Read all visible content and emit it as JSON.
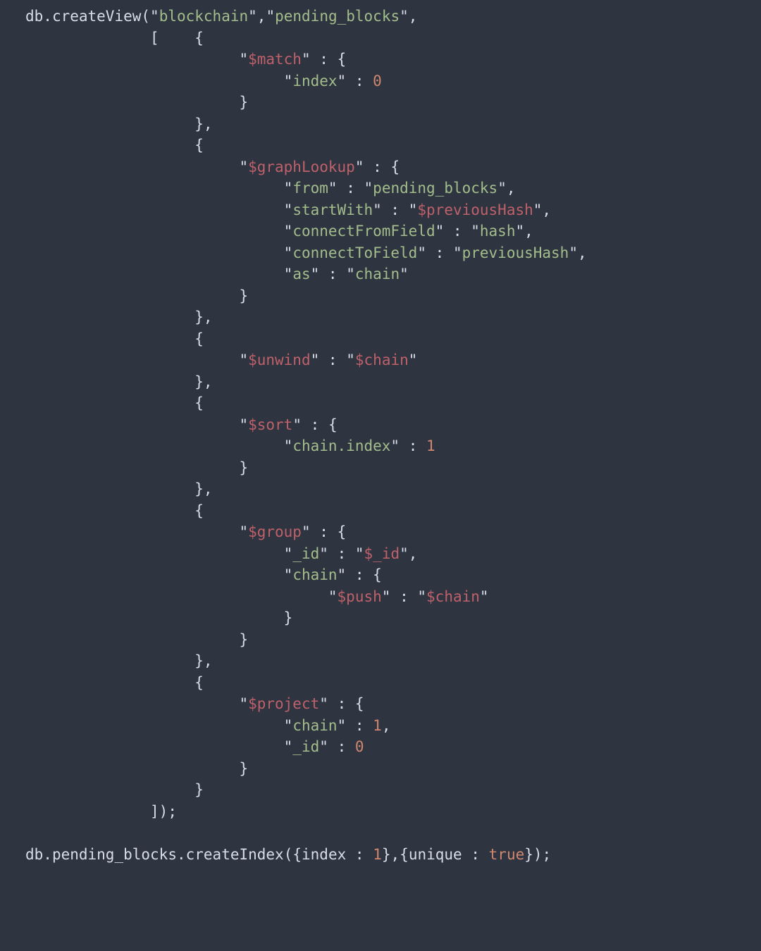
{
  "code": {
    "tokens": [
      {
        "c": "t-ident",
        "t": "db"
      },
      {
        "c": "t-punct",
        "t": "."
      },
      {
        "c": "t-ident",
        "t": "createView"
      },
      {
        "c": "t-punct",
        "t": "("
      },
      {
        "c": "t-punct",
        "t": "\""
      },
      {
        "c": "t-string",
        "t": "blockchain"
      },
      {
        "c": "t-punct",
        "t": "\""
      },
      {
        "c": "t-punct",
        "t": ","
      },
      {
        "c": "t-punct",
        "t": "\""
      },
      {
        "c": "t-string",
        "t": "pending_blocks"
      },
      {
        "c": "t-punct",
        "t": "\""
      },
      {
        "c": "t-punct",
        "t": ","
      },
      {
        "nl": true
      },
      {
        "c": "t-default",
        "t": "              "
      },
      {
        "c": "t-punct",
        "t": "["
      },
      {
        "c": "t-default",
        "t": "    "
      },
      {
        "c": "t-punct",
        "t": "{"
      },
      {
        "nl": true
      },
      {
        "c": "t-default",
        "t": "                        "
      },
      {
        "c": "t-punct",
        "t": "\""
      },
      {
        "c": "t-dollar",
        "t": "$match"
      },
      {
        "c": "t-punct",
        "t": "\""
      },
      {
        "c": "t-default",
        "t": " "
      },
      {
        "c": "t-punct",
        "t": ":"
      },
      {
        "c": "t-default",
        "t": " "
      },
      {
        "c": "t-punct",
        "t": "{"
      },
      {
        "nl": true
      },
      {
        "c": "t-default",
        "t": "                             "
      },
      {
        "c": "t-punct",
        "t": "\""
      },
      {
        "c": "t-string",
        "t": "index"
      },
      {
        "c": "t-punct",
        "t": "\""
      },
      {
        "c": "t-default",
        "t": " "
      },
      {
        "c": "t-punct",
        "t": ":"
      },
      {
        "c": "t-default",
        "t": " "
      },
      {
        "c": "t-number",
        "t": "0"
      },
      {
        "nl": true
      },
      {
        "c": "t-default",
        "t": "                        "
      },
      {
        "c": "t-punct",
        "t": "}"
      },
      {
        "nl": true
      },
      {
        "c": "t-default",
        "t": "                   "
      },
      {
        "c": "t-punct",
        "t": "}"
      },
      {
        "c": "t-punct",
        "t": ","
      },
      {
        "nl": true
      },
      {
        "c": "t-default",
        "t": "                   "
      },
      {
        "c": "t-punct",
        "t": "{"
      },
      {
        "nl": true
      },
      {
        "c": "t-default",
        "t": "                        "
      },
      {
        "c": "t-punct",
        "t": "\""
      },
      {
        "c": "t-dollar",
        "t": "$graphLookup"
      },
      {
        "c": "t-punct",
        "t": "\""
      },
      {
        "c": "t-default",
        "t": " "
      },
      {
        "c": "t-punct",
        "t": ":"
      },
      {
        "c": "t-default",
        "t": " "
      },
      {
        "c": "t-punct",
        "t": "{"
      },
      {
        "nl": true
      },
      {
        "c": "t-default",
        "t": "                             "
      },
      {
        "c": "t-punct",
        "t": "\""
      },
      {
        "c": "t-string",
        "t": "from"
      },
      {
        "c": "t-punct",
        "t": "\""
      },
      {
        "c": "t-default",
        "t": " "
      },
      {
        "c": "t-punct",
        "t": ":"
      },
      {
        "c": "t-default",
        "t": " "
      },
      {
        "c": "t-punct",
        "t": "\""
      },
      {
        "c": "t-string",
        "t": "pending_blocks"
      },
      {
        "c": "t-punct",
        "t": "\""
      },
      {
        "c": "t-punct",
        "t": ","
      },
      {
        "nl": true
      },
      {
        "c": "t-default",
        "t": "                             "
      },
      {
        "c": "t-punct",
        "t": "\""
      },
      {
        "c": "t-string",
        "t": "startWith"
      },
      {
        "c": "t-punct",
        "t": "\""
      },
      {
        "c": "t-default",
        "t": " "
      },
      {
        "c": "t-punct",
        "t": ":"
      },
      {
        "c": "t-default",
        "t": " "
      },
      {
        "c": "t-punct",
        "t": "\""
      },
      {
        "c": "t-dollar",
        "t": "$previousHash"
      },
      {
        "c": "t-punct",
        "t": "\""
      },
      {
        "c": "t-punct",
        "t": ","
      },
      {
        "nl": true
      },
      {
        "c": "t-default",
        "t": "                             "
      },
      {
        "c": "t-punct",
        "t": "\""
      },
      {
        "c": "t-string",
        "t": "connectFromField"
      },
      {
        "c": "t-punct",
        "t": "\""
      },
      {
        "c": "t-default",
        "t": " "
      },
      {
        "c": "t-punct",
        "t": ":"
      },
      {
        "c": "t-default",
        "t": " "
      },
      {
        "c": "t-punct",
        "t": "\""
      },
      {
        "c": "t-string",
        "t": "hash"
      },
      {
        "c": "t-punct",
        "t": "\""
      },
      {
        "c": "t-punct",
        "t": ","
      },
      {
        "nl": true
      },
      {
        "c": "t-default",
        "t": "                             "
      },
      {
        "c": "t-punct",
        "t": "\""
      },
      {
        "c": "t-string",
        "t": "connectToField"
      },
      {
        "c": "t-punct",
        "t": "\""
      },
      {
        "c": "t-default",
        "t": " "
      },
      {
        "c": "t-punct",
        "t": ":"
      },
      {
        "c": "t-default",
        "t": " "
      },
      {
        "c": "t-punct",
        "t": "\""
      },
      {
        "c": "t-string",
        "t": "previousHash"
      },
      {
        "c": "t-punct",
        "t": "\""
      },
      {
        "c": "t-punct",
        "t": ","
      },
      {
        "nl": true
      },
      {
        "c": "t-default",
        "t": "                             "
      },
      {
        "c": "t-punct",
        "t": "\""
      },
      {
        "c": "t-string",
        "t": "as"
      },
      {
        "c": "t-punct",
        "t": "\""
      },
      {
        "c": "t-default",
        "t": " "
      },
      {
        "c": "t-punct",
        "t": ":"
      },
      {
        "c": "t-default",
        "t": " "
      },
      {
        "c": "t-punct",
        "t": "\""
      },
      {
        "c": "t-string",
        "t": "chain"
      },
      {
        "c": "t-punct",
        "t": "\""
      },
      {
        "nl": true
      },
      {
        "c": "t-default",
        "t": "                        "
      },
      {
        "c": "t-punct",
        "t": "}"
      },
      {
        "nl": true
      },
      {
        "c": "t-default",
        "t": "                   "
      },
      {
        "c": "t-punct",
        "t": "}"
      },
      {
        "c": "t-punct",
        "t": ","
      },
      {
        "nl": true
      },
      {
        "c": "t-default",
        "t": "                   "
      },
      {
        "c": "t-punct",
        "t": "{"
      },
      {
        "nl": true
      },
      {
        "c": "t-default",
        "t": "                        "
      },
      {
        "c": "t-punct",
        "t": "\""
      },
      {
        "c": "t-dollar",
        "t": "$unwind"
      },
      {
        "c": "t-punct",
        "t": "\""
      },
      {
        "c": "t-default",
        "t": " "
      },
      {
        "c": "t-punct",
        "t": ":"
      },
      {
        "c": "t-default",
        "t": " "
      },
      {
        "c": "t-punct",
        "t": "\""
      },
      {
        "c": "t-dollar",
        "t": "$chain"
      },
      {
        "c": "t-punct",
        "t": "\""
      },
      {
        "nl": true
      },
      {
        "c": "t-default",
        "t": "                   "
      },
      {
        "c": "t-punct",
        "t": "}"
      },
      {
        "c": "t-punct",
        "t": ","
      },
      {
        "nl": true
      },
      {
        "c": "t-default",
        "t": "                   "
      },
      {
        "c": "t-punct",
        "t": "{"
      },
      {
        "nl": true
      },
      {
        "c": "t-default",
        "t": "                        "
      },
      {
        "c": "t-punct",
        "t": "\""
      },
      {
        "c": "t-dollar",
        "t": "$sort"
      },
      {
        "c": "t-punct",
        "t": "\""
      },
      {
        "c": "t-default",
        "t": " "
      },
      {
        "c": "t-punct",
        "t": ":"
      },
      {
        "c": "t-default",
        "t": " "
      },
      {
        "c": "t-punct",
        "t": "{"
      },
      {
        "nl": true
      },
      {
        "c": "t-default",
        "t": "                             "
      },
      {
        "c": "t-punct",
        "t": "\""
      },
      {
        "c": "t-string",
        "t": "chain.index"
      },
      {
        "c": "t-punct",
        "t": "\""
      },
      {
        "c": "t-default",
        "t": " "
      },
      {
        "c": "t-punct",
        "t": ":"
      },
      {
        "c": "t-default",
        "t": " "
      },
      {
        "c": "t-number",
        "t": "1"
      },
      {
        "nl": true
      },
      {
        "c": "t-default",
        "t": "                        "
      },
      {
        "c": "t-punct",
        "t": "}"
      },
      {
        "nl": true
      },
      {
        "c": "t-default",
        "t": "                   "
      },
      {
        "c": "t-punct",
        "t": "}"
      },
      {
        "c": "t-punct",
        "t": ","
      },
      {
        "nl": true
      },
      {
        "c": "t-default",
        "t": "                   "
      },
      {
        "c": "t-punct",
        "t": "{"
      },
      {
        "nl": true
      },
      {
        "c": "t-default",
        "t": "                        "
      },
      {
        "c": "t-punct",
        "t": "\""
      },
      {
        "c": "t-dollar",
        "t": "$group"
      },
      {
        "c": "t-punct",
        "t": "\""
      },
      {
        "c": "t-default",
        "t": " "
      },
      {
        "c": "t-punct",
        "t": ":"
      },
      {
        "c": "t-default",
        "t": " "
      },
      {
        "c": "t-punct",
        "t": "{"
      },
      {
        "nl": true
      },
      {
        "c": "t-default",
        "t": "                             "
      },
      {
        "c": "t-punct",
        "t": "\""
      },
      {
        "c": "t-string",
        "t": "_id"
      },
      {
        "c": "t-punct",
        "t": "\""
      },
      {
        "c": "t-default",
        "t": " "
      },
      {
        "c": "t-punct",
        "t": ":"
      },
      {
        "c": "t-default",
        "t": " "
      },
      {
        "c": "t-punct",
        "t": "\""
      },
      {
        "c": "t-dollar",
        "t": "$_id"
      },
      {
        "c": "t-punct",
        "t": "\""
      },
      {
        "c": "t-punct",
        "t": ","
      },
      {
        "nl": true
      },
      {
        "c": "t-default",
        "t": "                             "
      },
      {
        "c": "t-punct",
        "t": "\""
      },
      {
        "c": "t-string",
        "t": "chain"
      },
      {
        "c": "t-punct",
        "t": "\""
      },
      {
        "c": "t-default",
        "t": " "
      },
      {
        "c": "t-punct",
        "t": ":"
      },
      {
        "c": "t-default",
        "t": " "
      },
      {
        "c": "t-punct",
        "t": "{"
      },
      {
        "nl": true
      },
      {
        "c": "t-default",
        "t": "                                  "
      },
      {
        "c": "t-punct",
        "t": "\""
      },
      {
        "c": "t-dollar",
        "t": "$push"
      },
      {
        "c": "t-punct",
        "t": "\""
      },
      {
        "c": "t-default",
        "t": " "
      },
      {
        "c": "t-punct",
        "t": ":"
      },
      {
        "c": "t-default",
        "t": " "
      },
      {
        "c": "t-punct",
        "t": "\""
      },
      {
        "c": "t-dollar",
        "t": "$chain"
      },
      {
        "c": "t-punct",
        "t": "\""
      },
      {
        "nl": true
      },
      {
        "c": "t-default",
        "t": "                             "
      },
      {
        "c": "t-punct",
        "t": "}"
      },
      {
        "nl": true
      },
      {
        "c": "t-default",
        "t": "                        "
      },
      {
        "c": "t-punct",
        "t": "}"
      },
      {
        "nl": true
      },
      {
        "c": "t-default",
        "t": "                   "
      },
      {
        "c": "t-punct",
        "t": "}"
      },
      {
        "c": "t-punct",
        "t": ","
      },
      {
        "nl": true
      },
      {
        "c": "t-default",
        "t": "                   "
      },
      {
        "c": "t-punct",
        "t": "{"
      },
      {
        "nl": true
      },
      {
        "c": "t-default",
        "t": "                        "
      },
      {
        "c": "t-punct",
        "t": "\""
      },
      {
        "c": "t-dollar",
        "t": "$project"
      },
      {
        "c": "t-punct",
        "t": "\""
      },
      {
        "c": "t-default",
        "t": " "
      },
      {
        "c": "t-punct",
        "t": ":"
      },
      {
        "c": "t-default",
        "t": " "
      },
      {
        "c": "t-punct",
        "t": "{"
      },
      {
        "nl": true
      },
      {
        "c": "t-default",
        "t": "                             "
      },
      {
        "c": "t-punct",
        "t": "\""
      },
      {
        "c": "t-string",
        "t": "chain"
      },
      {
        "c": "t-punct",
        "t": "\""
      },
      {
        "c": "t-default",
        "t": " "
      },
      {
        "c": "t-punct",
        "t": ":"
      },
      {
        "c": "t-default",
        "t": " "
      },
      {
        "c": "t-number",
        "t": "1"
      },
      {
        "c": "t-punct",
        "t": ","
      },
      {
        "nl": true
      },
      {
        "c": "t-default",
        "t": "                             "
      },
      {
        "c": "t-punct",
        "t": "\""
      },
      {
        "c": "t-string",
        "t": "_id"
      },
      {
        "c": "t-punct",
        "t": "\""
      },
      {
        "c": "t-default",
        "t": " "
      },
      {
        "c": "t-punct",
        "t": ":"
      },
      {
        "c": "t-default",
        "t": " "
      },
      {
        "c": "t-number",
        "t": "0"
      },
      {
        "nl": true
      },
      {
        "c": "t-default",
        "t": "                        "
      },
      {
        "c": "t-punct",
        "t": "}"
      },
      {
        "nl": true
      },
      {
        "c": "t-default",
        "t": "                   "
      },
      {
        "c": "t-punct",
        "t": "}"
      },
      {
        "nl": true
      },
      {
        "c": "t-default",
        "t": "              "
      },
      {
        "c": "t-punct",
        "t": "]"
      },
      {
        "c": "t-punct",
        "t": ")"
      },
      {
        "c": "t-punct",
        "t": ";"
      },
      {
        "nl": true
      },
      {
        "nl": true
      },
      {
        "c": "t-ident",
        "t": "db"
      },
      {
        "c": "t-punct",
        "t": "."
      },
      {
        "c": "t-ident",
        "t": "pending_blocks"
      },
      {
        "c": "t-punct",
        "t": "."
      },
      {
        "c": "t-ident",
        "t": "createIndex"
      },
      {
        "c": "t-punct",
        "t": "("
      },
      {
        "c": "t-punct",
        "t": "{"
      },
      {
        "c": "t-ident",
        "t": "index"
      },
      {
        "c": "t-default",
        "t": " "
      },
      {
        "c": "t-punct",
        "t": ":"
      },
      {
        "c": "t-default",
        "t": " "
      },
      {
        "c": "t-number",
        "t": "1"
      },
      {
        "c": "t-punct",
        "t": "}"
      },
      {
        "c": "t-punct",
        "t": ","
      },
      {
        "c": "t-punct",
        "t": "{"
      },
      {
        "c": "t-ident",
        "t": "unique"
      },
      {
        "c": "t-default",
        "t": " "
      },
      {
        "c": "t-punct",
        "t": ":"
      },
      {
        "c": "t-default",
        "t": " "
      },
      {
        "c": "t-bool",
        "t": "true"
      },
      {
        "c": "t-punct",
        "t": "}"
      },
      {
        "c": "t-punct",
        "t": ")"
      },
      {
        "c": "t-punct",
        "t": ";"
      }
    ]
  }
}
